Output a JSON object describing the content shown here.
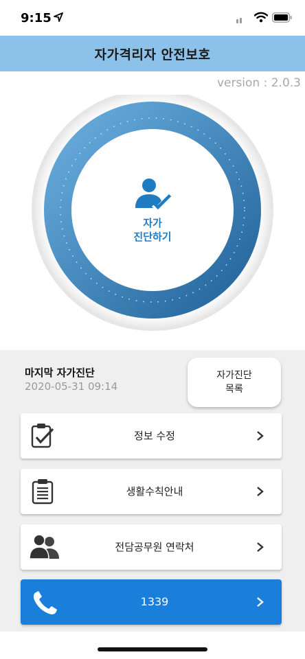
{
  "status_bar": {
    "time": "9:15"
  },
  "header": {
    "title": "자가격리자 안전보호"
  },
  "version": "version : 2.0.3",
  "dial": {
    "label_line1": "자가",
    "label_line2": "진단하기",
    "icon": "user-check-icon",
    "accent": "#1f7cc3"
  },
  "last_diagnosis": {
    "label": "마지막 자가진단",
    "datetime": "2020-05-31 09:14"
  },
  "list_button": {
    "line1": "자가진단",
    "line2": "목록"
  },
  "menu": [
    {
      "label": "정보 수정",
      "icon": "clipboard-check-icon"
    },
    {
      "label": "생활수칙안내",
      "icon": "clipboard-list-icon"
    },
    {
      "label": "전담공무원 연락처",
      "icon": "contacts-icon"
    }
  ],
  "call": {
    "label": "1339",
    "icon": "phone-icon",
    "color": "#1a7fdb"
  },
  "colors": {
    "header_bg": "#8cc1ea",
    "panel_bg": "#efefef"
  }
}
